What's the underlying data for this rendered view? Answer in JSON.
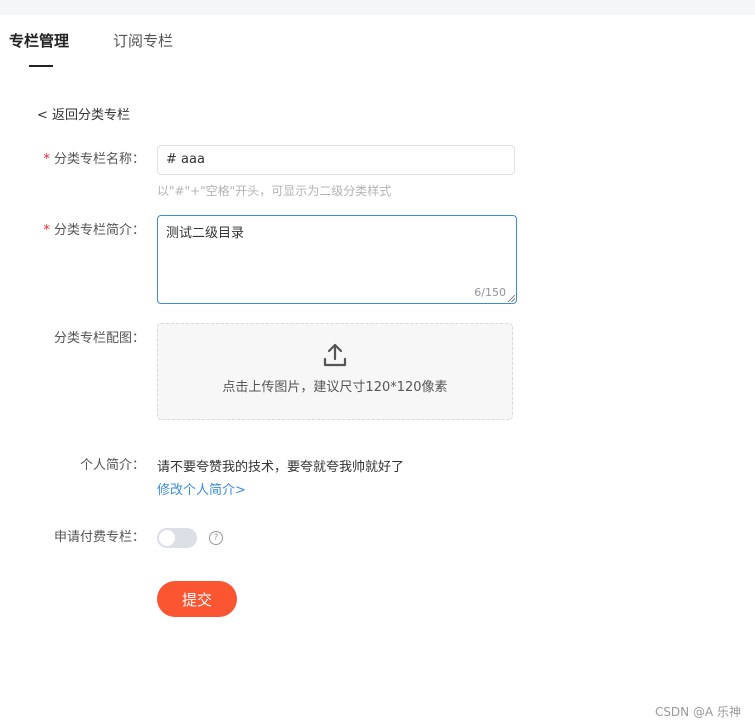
{
  "tabs": [
    {
      "label": "专栏管理",
      "active": true
    },
    {
      "label": "订阅专栏",
      "active": false
    }
  ],
  "back_link": "< 返回分类专栏",
  "form": {
    "required_mark": "*",
    "name": {
      "label": "分类专栏名称：",
      "value": "# aaa",
      "hint": "以\"#\"+\"空格\"开头，可显示为二级分类样式"
    },
    "desc": {
      "label": "分类专栏简介：",
      "value": "测试二级目录",
      "counter": "6/150"
    },
    "image": {
      "label": "分类专栏配图：",
      "upload_text": "点击上传图片，建议尺寸120*120像素",
      "icon": "upload-icon"
    },
    "personal_intro": {
      "label": "个人简介：",
      "text": "请不要夸赞我的技术，要夸就夸我帅就好了",
      "link": "修改个人简介>"
    },
    "paid_column": {
      "label": "申请付费专栏：",
      "enabled": false,
      "help_icon": "?"
    },
    "submit_label": "提交"
  },
  "watermark": "CSDN @A 乐神",
  "colors": {
    "accent": "#fc5531",
    "link": "#3c8ce7",
    "required": "#f5222d",
    "focus_border": "#3b8ed9"
  }
}
